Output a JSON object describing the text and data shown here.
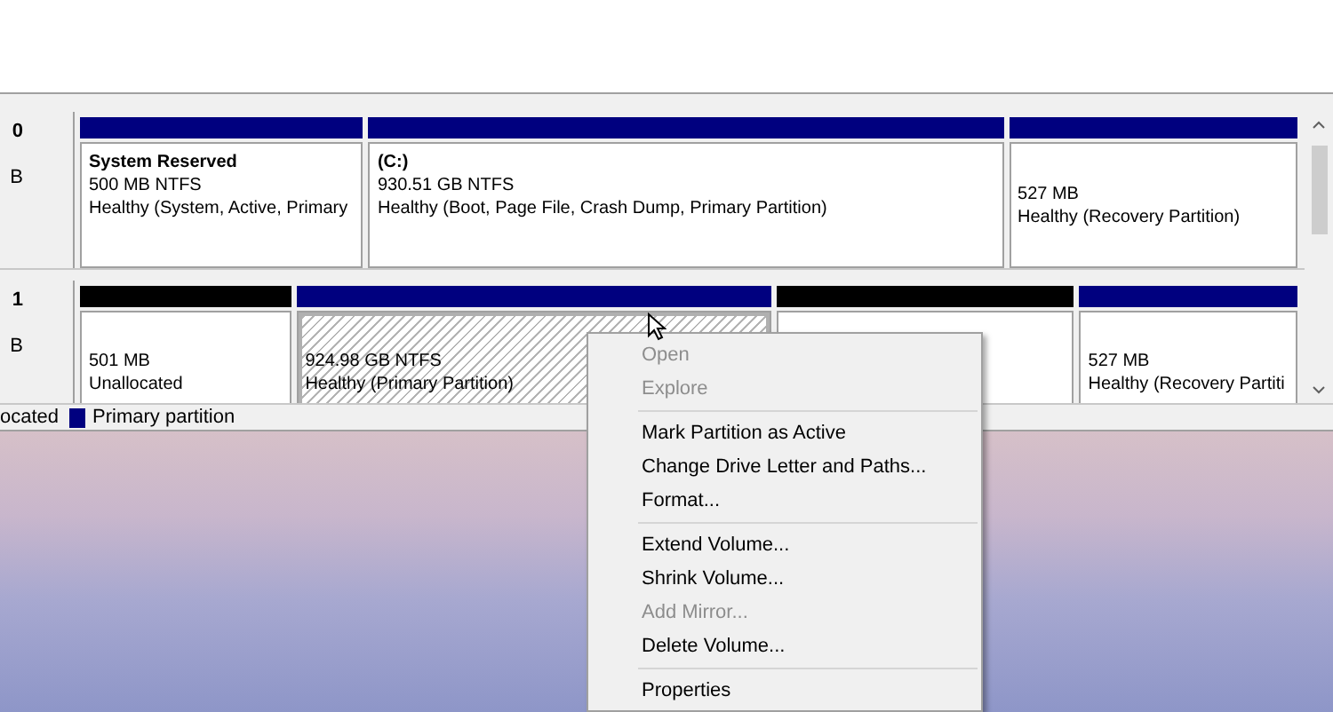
{
  "disks": [
    {
      "number": "0",
      "size": "B",
      "partitions": [
        {
          "kind": "primary",
          "selected": false,
          "name": "System Reserved",
          "size": "500 MB NTFS",
          "status": "Healthy (System, Active, Primary"
        },
        {
          "kind": "primary",
          "selected": false,
          "name": "(C:)",
          "size": "930.51 GB NTFS",
          "status": "Healthy (Boot, Page File, Crash Dump, Primary Partition)"
        },
        {
          "kind": "primary",
          "selected": false,
          "size": "527 MB",
          "status": "Healthy (Recovery Partition)"
        }
      ]
    },
    {
      "number": "1",
      "size": "B",
      "partitions": [
        {
          "kind": "unallocated",
          "selected": false,
          "size": "501 MB",
          "status": "Unallocated"
        },
        {
          "kind": "primary",
          "selected": true,
          "size": "924.98 GB NTFS",
          "status": "Healthy (Primary Partition)"
        },
        {
          "kind": "unallocated",
          "selected": false
        },
        {
          "kind": "primary",
          "selected": false,
          "size": "527 MB",
          "status": "Healthy (Recovery Partiti"
        }
      ]
    }
  ],
  "legend": [
    {
      "label": "ocated"
    },
    {
      "label": "Primary partition",
      "color": "#00007f"
    }
  ],
  "context_menu": [
    {
      "kind": "item",
      "label": "Open",
      "disabled": true
    },
    {
      "kind": "item",
      "label": "Explore",
      "disabled": true
    },
    {
      "kind": "separator"
    },
    {
      "kind": "item",
      "label": "Mark Partition as Active",
      "disabled": false
    },
    {
      "kind": "item",
      "label": "Change Drive Letter and Paths...",
      "disabled": false
    },
    {
      "kind": "item",
      "label": "Format...",
      "disabled": false
    },
    {
      "kind": "separator"
    },
    {
      "kind": "item",
      "label": "Extend Volume...",
      "disabled": false
    },
    {
      "kind": "item",
      "label": "Shrink Volume...",
      "disabled": false
    },
    {
      "kind": "item",
      "label": "Add Mirror...",
      "disabled": true
    },
    {
      "kind": "item",
      "label": "Delete Volume...",
      "disabled": false
    },
    {
      "kind": "separator"
    },
    {
      "kind": "item",
      "label": "Properties",
      "disabled": false
    }
  ]
}
